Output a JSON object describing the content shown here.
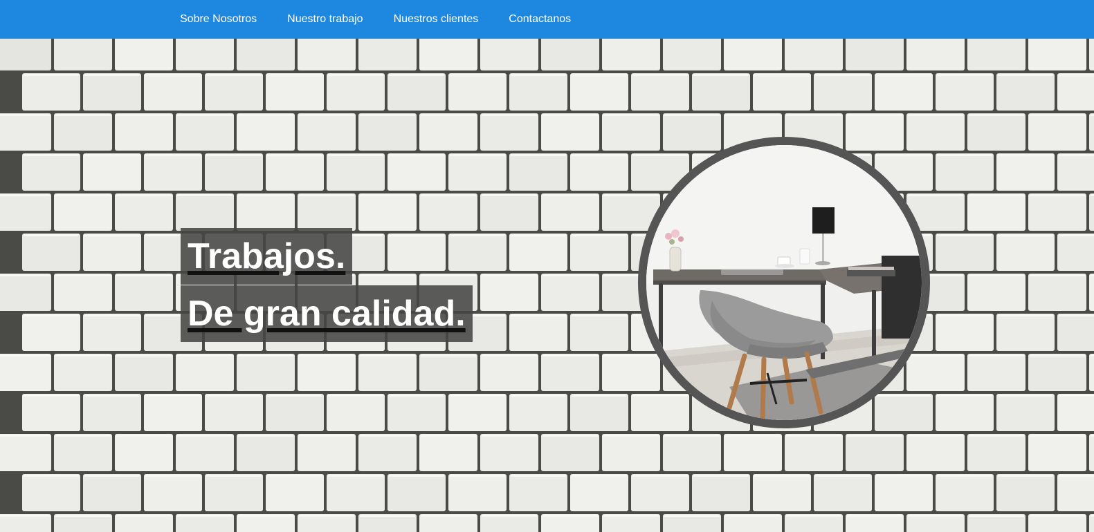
{
  "nav": {
    "items": [
      {
        "label": "Sobre Nosotros"
      },
      {
        "label": "Nuestro trabajo"
      },
      {
        "label": "Nuestros clientes"
      },
      {
        "label": "Contactanos"
      }
    ]
  },
  "hero": {
    "line1": "Trabajos.",
    "line2": "De gran calidad."
  },
  "photo": {
    "subject": "office-desk-with-grey-chair"
  },
  "colors": {
    "navbar": "#1e88e0",
    "nav_text": "#ffffff",
    "headline_bg": "#464644",
    "headline_text": "#ffffff",
    "photo_border": "#555555",
    "brick": "#ecece9",
    "mortar": "#4a4a47"
  }
}
